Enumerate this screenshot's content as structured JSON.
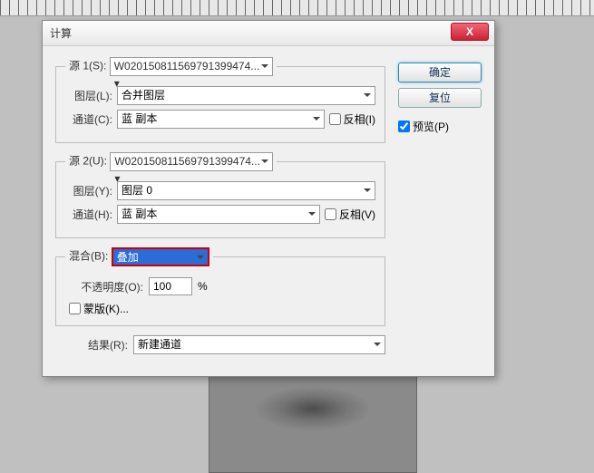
{
  "dialog": {
    "title": "计算",
    "close": "X",
    "source1": {
      "legend": "源 1(S):",
      "file": "W020150811569791399474... ▾",
      "layer_label": "图层(L):",
      "layer": "合并图层",
      "channel_label": "通道(C):",
      "channel": "蓝 副本",
      "invert": "反相(I)"
    },
    "source2": {
      "legend": "源 2(U):",
      "file": "W020150811569791399474... ▾",
      "layer_label": "图层(Y):",
      "layer": "图层 0",
      "channel_label": "通道(H):",
      "channel": "蓝 副本",
      "invert": "反相(V)"
    },
    "blend": {
      "legend": "混合(B):",
      "mode": "叠加",
      "opacity_label": "不透明度(O):",
      "opacity": "100",
      "opacity_suffix": "%",
      "mask": "蒙版(K)..."
    },
    "result": {
      "label": "结果(R):",
      "value": "新建通道"
    },
    "buttons": {
      "ok": "确定",
      "cancel": "复位",
      "preview": "预览(P)"
    }
  }
}
